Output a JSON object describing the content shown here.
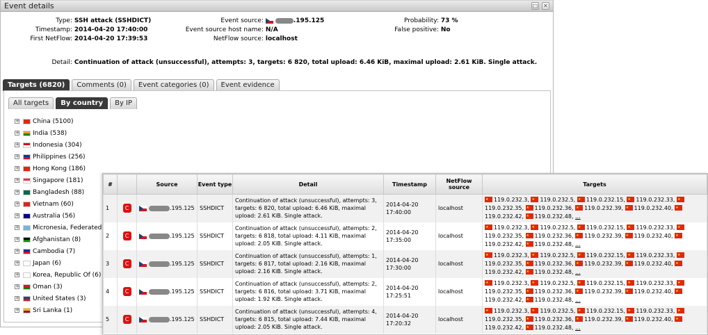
{
  "window": {
    "title": "Event details"
  },
  "info": {
    "type_label": "Type:",
    "type_value": "SSH attack (SSHDICT)",
    "timestamp_label": "Timestamp:",
    "timestamp_value": "2014-04-20 17:40:00",
    "first_netflow_label": "First NetFlow:",
    "first_netflow_value": "2014-04-20 17:39:53",
    "event_source_label": "Event source:",
    "event_source_value": ".195.125",
    "host_name_label": "Event source host name:",
    "host_name_value": "N/A",
    "netflow_source_label": "NetFlow source:",
    "netflow_source_value": "localhost",
    "probability_label": "Probability:",
    "probability_value": "73 %",
    "false_positive_label": "False positive:",
    "false_positive_value": "No",
    "detail_label": "Detail:",
    "detail_value": "Continuation of attack (unsuccessful), attempts: 3, targets: 6 820, total upload: 6.46 KiB, maximal upload: 2.61 KiB. Single attack."
  },
  "main_tabs": [
    "Targets (6820)",
    "Comments (0)",
    "Event categories (0)",
    "Event evidence"
  ],
  "sub_tabs": [
    "All targets",
    "By country",
    "By IP"
  ],
  "countries": [
    {
      "name": "China (5100)",
      "flag": [
        "#de2910",
        "#de2910"
      ]
    },
    {
      "name": "India (538)",
      "flag": [
        "#ff9933",
        "#138808"
      ]
    },
    {
      "name": "Indonesia (304)",
      "flag": [
        "#ce1126",
        "#ffffff"
      ]
    },
    {
      "name": "Philippines (256)",
      "flag": [
        "#0038a8",
        "#ce1126"
      ]
    },
    {
      "name": "Hong Kong (186)",
      "flag": [
        "#de2910",
        "#de2910"
      ]
    },
    {
      "name": "Singapore (181)",
      "flag": [
        "#ef3340",
        "#ffffff"
      ]
    },
    {
      "name": "Bangladesh (88)",
      "flag": [
        "#006a4e",
        "#006a4e"
      ]
    },
    {
      "name": "Vietnam (60)",
      "flag": [
        "#da251d",
        "#da251d"
      ]
    },
    {
      "name": "Australia (56)",
      "flag": [
        "#00008b",
        "#00008b"
      ]
    },
    {
      "name": "Micronesia, Federated S",
      "flag": [
        "#75b2dd",
        "#75b2dd"
      ]
    },
    {
      "name": "Afghanistan (8)",
      "flag": [
        "#000000",
        "#009900"
      ]
    },
    {
      "name": "Cambodia (7)",
      "flag": [
        "#032ea1",
        "#e00025"
      ]
    },
    {
      "name": "Japan (6)",
      "flag": [
        "#ffffff",
        "#ffffff"
      ]
    },
    {
      "name": "Korea, Republic Of (6)",
      "flag": [
        "#ffffff",
        "#ffffff"
      ]
    },
    {
      "name": "Oman (3)",
      "flag": [
        "#db161b",
        "#008000"
      ]
    },
    {
      "name": "United States (3)",
      "flag": [
        "#3c3b6e",
        "#b22234"
      ]
    },
    {
      "name": "Sri Lanka (1)",
      "flag": [
        "#ffb700",
        "#8d153a"
      ]
    }
  ],
  "events_table": {
    "headers": [
      "#",
      "",
      "Source",
      "Event type",
      "Detail",
      "Timestamp",
      "NetFlow source",
      "Targets"
    ],
    "rows": [
      {
        "n": "1",
        "badge": "C",
        "source": ".195.125",
        "type": "SSHDICT",
        "detail": "Continuation of attack (unsuccessful), attempts: 3, targets: 6 820, total upload: 6.46 KiB, maximal upload: 2.61 KiB. Single attack.",
        "date": "2014-04-20",
        "time": "17:40:00",
        "netflow": "localhost"
      },
      {
        "n": "2",
        "badge": "C",
        "source": ".195.125",
        "type": "SSHDICT",
        "detail": "Continuation of attack (unsuccessful), attempts: 2, targets: 6 818, total upload: 4.11 KiB, maximal upload: 2.05 KiB. Single attack.",
        "date": "2014-04-20",
        "time": "17:35:00",
        "netflow": "localhost"
      },
      {
        "n": "3",
        "badge": "C",
        "source": ".195.125",
        "type": "SSHDICT",
        "detail": "Continuation of attack (unsuccessful), attempts: 1, targets: 6 817, total upload: 2.16 KiB, maximal upload: 2.16 KiB. Single attack.",
        "date": "2014-04-20",
        "time": "17:30:00",
        "netflow": "localhost"
      },
      {
        "n": "4",
        "badge": "C",
        "source": ".195.125",
        "type": "SSHDICT",
        "detail": "Continuation of attack (unsuccessful), attempts: 2, targets: 6 816, total upload: 3.71 KiB, maximal upload: 1.92 KiB. Single attack.",
        "date": "2014-04-20",
        "time": "17:25:51",
        "netflow": "localhost"
      },
      {
        "n": "5",
        "badge": "C",
        "source": ".195.125",
        "type": "SSHDICT",
        "detail": "Continuation of attack (unsuccessful), attempts: 4, targets: 6 815, total upload: 7.44 KiB, maximal upload: 2.05 KiB. Single attack.",
        "date": "2014-04-20",
        "time": "17:20:32",
        "netflow": "localhost"
      }
    ],
    "target_ips": [
      "119.0.232.3,",
      "119.0.232.5,",
      "119.0.232.15,",
      "119.0.232.33,",
      "119.0.232.35,",
      "119.0.232.36,",
      "119.0.232.39,",
      "119.0.232.40,",
      "119.0.232.42,",
      "119.0.232.48,"
    ],
    "more": "..."
  }
}
